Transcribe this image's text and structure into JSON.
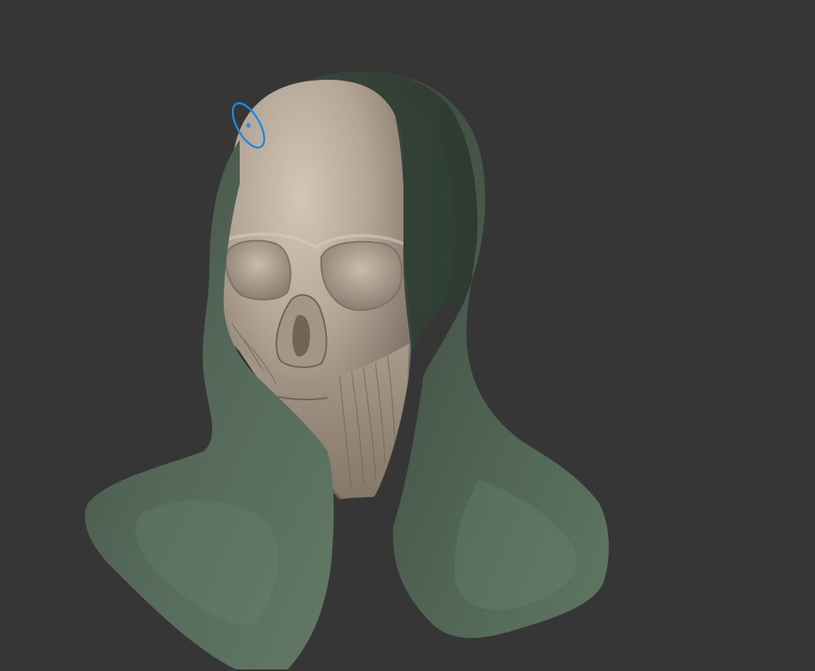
{
  "viewport": {
    "background": "#363636"
  },
  "model": {
    "skull_color": "#c2b6a7",
    "hood_color": "#5d7560",
    "hood_shadow_color": "#2f3a31"
  },
  "brush_cursor": {
    "icon": "sculpt-brush-cursor-icon",
    "color": "#1e88e5"
  }
}
